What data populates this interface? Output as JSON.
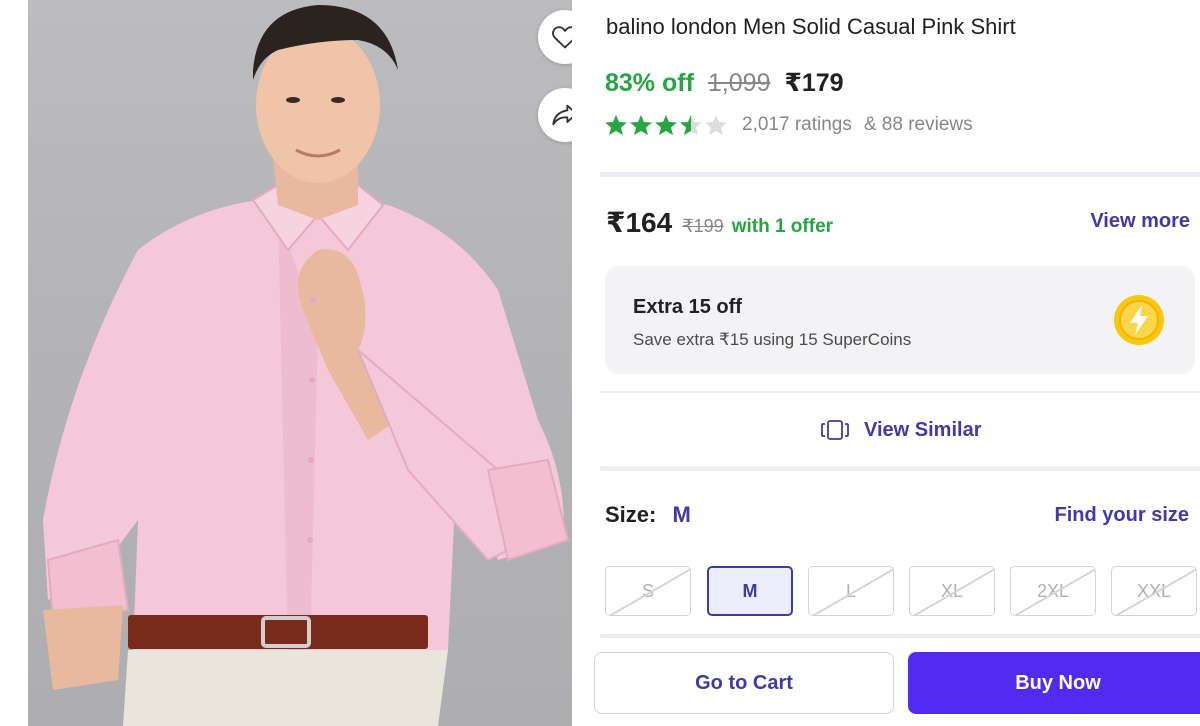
{
  "product": {
    "title": "balino london Men Solid Casual Pink Shirt",
    "discount": "83% off",
    "mrp": "1,099",
    "price": "₹179",
    "rating_value": 3.5,
    "ratings_count": "2,017 ratings",
    "reviews_count": "& 88 reviews"
  },
  "offer": {
    "price": "₹164",
    "mrp": "₹199",
    "text": "with 1 offer",
    "view_more": "View more"
  },
  "supercoins": {
    "title": "Extra 15 off",
    "subtitle": "Save extra ₹15 using 15 SuperCoins",
    "icon": "supercoin-lightning-icon"
  },
  "similar": {
    "label": "View Similar",
    "icon": "view-similar-icon"
  },
  "size": {
    "label": "Size:",
    "selected": "M",
    "find_size": "Find your size",
    "options": [
      {
        "label": "S",
        "available": false
      },
      {
        "label": "M",
        "available": true,
        "selected": true
      },
      {
        "label": "L",
        "available": false
      },
      {
        "label": "XL",
        "available": false
      },
      {
        "label": "2XL",
        "available": false
      },
      {
        "label": "XXL",
        "available": false
      }
    ]
  },
  "actions": {
    "cart": "Go to Cart",
    "buy": "Buy Now"
  },
  "colors": {
    "accent": "#3f3aa8",
    "buy_button": "#512bf0",
    "green": "#26a541",
    "muted": "#878787",
    "coin": "#f9c80e"
  },
  "icons": {
    "wishlist": "heart-icon",
    "share": "share-icon",
    "star": "star-icon"
  }
}
